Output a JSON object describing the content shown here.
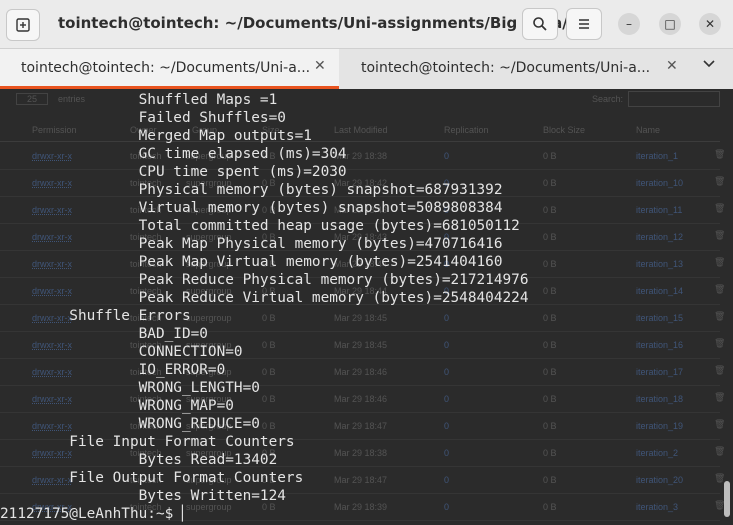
{
  "titlebar": {
    "title": "tointech@tointech: ~/Documents/Uni-assignments/Big Data/...",
    "new_tab_icon": "new-tab-icon",
    "search_icon": "search-icon",
    "menu_icon": "hamburger-icon",
    "minimize": "–",
    "maximize": "□",
    "close": "✕"
  },
  "tabs": [
    {
      "label": "tointech@tointech: ~/Documents/Uni-a...",
      "close": "✕",
      "active": true
    },
    {
      "label": "tointech@tointech: ~/Documents/Uni-a...",
      "close": "✕",
      "active": false
    }
  ],
  "tabs_dropdown": "⌄",
  "background": {
    "show_select": "25",
    "entries_label": "entries",
    "search_label": "Search:",
    "headers": [
      "Permission",
      "Owner",
      "Group",
      "Size",
      "Last Modified",
      "Replication",
      "Block Size",
      "Name"
    ],
    "rows": [
      {
        "perm": "drwxr-xr-x",
        "owner": "tointech",
        "group": "supergroup",
        "size": "0 B",
        "modified": "Mar 29 18:38",
        "replication": "0",
        "block": "0 B",
        "name": "iteration_1"
      },
      {
        "perm": "drwxr-xr-x",
        "owner": "tointech",
        "group": "supergroup",
        "size": "0 B",
        "modified": "Mar 29 18:42",
        "replication": "0",
        "block": "0 B",
        "name": "iteration_10"
      },
      {
        "perm": "drwxr-xr-x",
        "owner": "tointech",
        "group": "supergroup",
        "size": "0 B",
        "modified": "Mar 29 18:43",
        "replication": "0",
        "block": "0 B",
        "name": "iteration_11"
      },
      {
        "perm": "drwxr-xr-x",
        "owner": "tointech",
        "group": "supergroup",
        "size": "0 B",
        "modified": "Mar 29 18:43",
        "replication": "0",
        "block": "0 B",
        "name": "iteration_12"
      },
      {
        "perm": "drwxr-xr-x",
        "owner": "tointech",
        "group": "supergroup",
        "size": "0 B",
        "modified": "Mar 29 18:44",
        "replication": "0",
        "block": "0 B",
        "name": "iteration_13"
      },
      {
        "perm": "drwxr-xr-x",
        "owner": "tointech",
        "group": "supergroup",
        "size": "0 B",
        "modified": "Mar 29 18:44",
        "replication": "0",
        "block": "0 B",
        "name": "iteration_14"
      },
      {
        "perm": "drwxr-xr-x",
        "owner": "tointech",
        "group": "supergroup",
        "size": "0 B",
        "modified": "Mar 29 18:45",
        "replication": "0",
        "block": "0 B",
        "name": "iteration_15"
      },
      {
        "perm": "drwxr-xr-x",
        "owner": "tointech",
        "group": "supergroup",
        "size": "0 B",
        "modified": "Mar 29 18:45",
        "replication": "0",
        "block": "0 B",
        "name": "iteration_16"
      },
      {
        "perm": "drwxr-xr-x",
        "owner": "tointech",
        "group": "supergroup",
        "size": "0 B",
        "modified": "Mar 29 18:46",
        "replication": "0",
        "block": "0 B",
        "name": "iteration_17"
      },
      {
        "perm": "drwxr-xr-x",
        "owner": "tointech",
        "group": "supergroup",
        "size": "0 B",
        "modified": "Mar 29 18:46",
        "replication": "0",
        "block": "0 B",
        "name": "iteration_18"
      },
      {
        "perm": "drwxr-xr-x",
        "owner": "tointech",
        "group": "supergroup",
        "size": "0 B",
        "modified": "Mar 29 18:47",
        "replication": "0",
        "block": "0 B",
        "name": "iteration_19"
      },
      {
        "perm": "drwxr-xr-x",
        "owner": "tointech",
        "group": "supergroup",
        "size": "0 B",
        "modified": "Mar 29 18:38",
        "replication": "0",
        "block": "0 B",
        "name": "iteration_2"
      },
      {
        "perm": "drwxr-xr-x",
        "owner": "tointech",
        "group": "supergroup",
        "size": "0 B",
        "modified": "Mar 29 18:47",
        "replication": "0",
        "block": "0 B",
        "name": "iteration_20"
      },
      {
        "perm": "drwxr-xr-x",
        "owner": "tointech",
        "group": "supergroup",
        "size": "0 B",
        "modified": "Mar 29 18:39",
        "replication": "0",
        "block": "0 B",
        "name": "iteration_3"
      }
    ]
  },
  "terminal": {
    "lines": [
      "                Shuffled Maps =1",
      "                Failed Shuffles=0",
      "                Merged Map outputs=1",
      "                GC time elapsed (ms)=304",
      "                CPU time spent (ms)=2030",
      "                Physical memory (bytes) snapshot=687931392",
      "                Virtual memory (bytes) snapshot=5089808384",
      "                Total committed heap usage (bytes)=681050112",
      "                Peak Map Physical memory (bytes)=470716416",
      "                Peak Map Virtual memory (bytes)=2541404160",
      "                Peak Reduce Physical memory (bytes)=217214976",
      "                Peak Reduce Virtual memory (bytes)=2548404224",
      "        Shuffle Errors",
      "                BAD_ID=0",
      "                CONNECTION=0",
      "                IO_ERROR=0",
      "                WRONG_LENGTH=0",
      "                WRONG_MAP=0",
      "                WRONG_REDUCE=0",
      "        File Input Format Counters",
      "                Bytes Read=13402",
      "        File Output Format Counters",
      "                Bytes Written=124"
    ],
    "prompt": "21127175@LeAnhThu:~$ ▏"
  }
}
